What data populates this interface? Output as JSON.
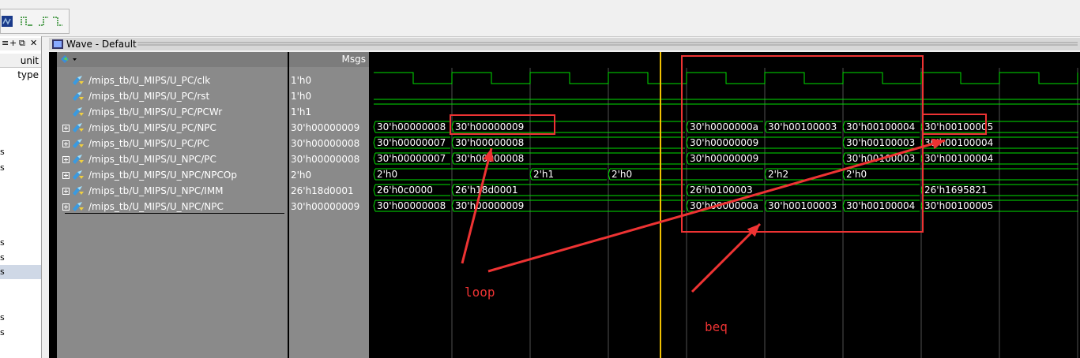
{
  "toolbar": {
    "icons": [
      "signal-icon",
      "step-icon",
      "edge-icon"
    ]
  },
  "left_panel": {
    "controls": [
      "≡",
      "+",
      "⧉",
      "✕"
    ],
    "header": "unit type",
    "rows": [
      "s",
      "s",
      "s",
      "s",
      "s",
      "s",
      "s"
    ]
  },
  "wave_window": {
    "title": "Wave - Default",
    "msgs_header": "Msgs"
  },
  "signals": [
    {
      "name": "/mips_tb/U_MIPS/U_PC/clk",
      "value": "1'h0",
      "expandable": false
    },
    {
      "name": "/mips_tb/U_MIPS/U_PC/rst",
      "value": "1'h0",
      "expandable": false
    },
    {
      "name": "/mips_tb/U_MIPS/U_PC/PCWr",
      "value": "1'h1",
      "expandable": false
    },
    {
      "name": "/mips_tb/U_MIPS/U_PC/NPC",
      "value": "30'h00000009",
      "expandable": true
    },
    {
      "name": "/mips_tb/U_MIPS/U_PC/PC",
      "value": "30'h00000008",
      "expandable": true
    },
    {
      "name": "/mips_tb/U_MIPS/U_NPC/PC",
      "value": "30'h00000008",
      "expandable": true
    },
    {
      "name": "/mips_tb/U_MIPS/U_NPC/NPCOp",
      "value": "2'h0",
      "expandable": true
    },
    {
      "name": "/mips_tb/U_MIPS/U_NPC/IMM",
      "value": "26'h18d0001",
      "expandable": true
    },
    {
      "name": "/mips_tb/U_MIPS/U_NPC/NPC",
      "value": "30'h00000009",
      "expandable": true
    }
  ],
  "bus_values": [
    [
      "30'h00000008",
      "30'h00000009",
      "",
      "",
      "30'h0000000a",
      "30'h00100003",
      "30'h00100004",
      "30'h00100005"
    ],
    [
      "30'h00000007",
      "30'h00000008",
      "",
      "",
      "30'h00000009",
      "",
      "30'h00100003",
      "30'h00100004"
    ],
    [
      "30'h00000007",
      "30'h00000008",
      "",
      "",
      "30'h00000009",
      "",
      "30'h00100003",
      "30'h00100004"
    ],
    [
      "2'h0",
      "",
      "2'h1",
      "2'h0",
      "",
      "2'h2",
      "2'h0",
      ""
    ],
    [
      "26'h0c0000",
      "26'h18d0001",
      "",
      "",
      "26'h0100003",
      "",
      "",
      "26'h1695821"
    ],
    [
      "30'h00000008",
      "30'h00000009",
      "",
      "",
      "30'h0000000a",
      "30'h00100003",
      "30'h00100004",
      "30'h00100005"
    ]
  ],
  "annotations": {
    "loop_label": "loop",
    "beq_label": "beq"
  },
  "colors": {
    "wave_green": "#00e000",
    "cursor": "#f0c000",
    "annotation_red": "#ee3333",
    "grid": "#505050"
  }
}
